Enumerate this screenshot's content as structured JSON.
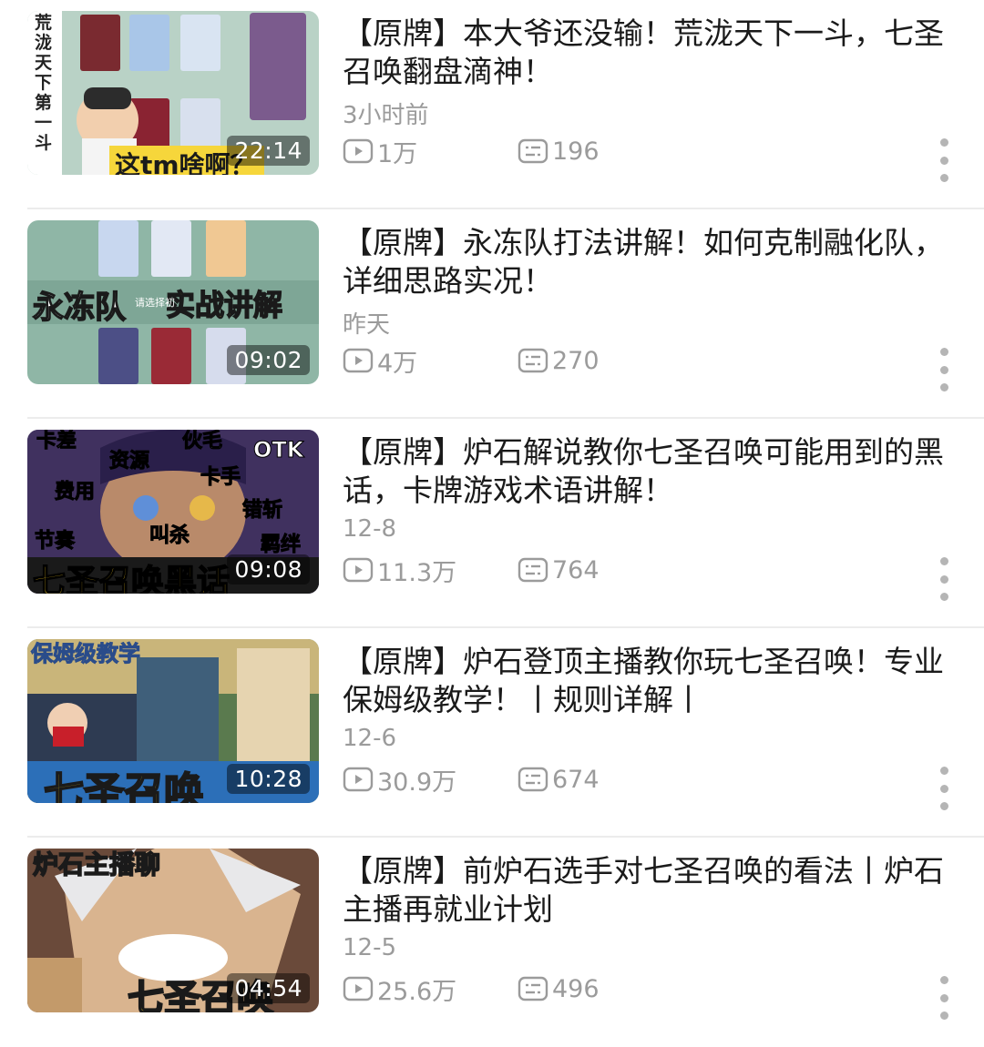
{
  "videos": [
    {
      "title": "【原牌】本大爷还没输！荒泷天下一斗，七圣召唤翻盘滴神！",
      "time": "3小时前",
      "duration": "22:14",
      "plays": "1万",
      "danmaku": "196",
      "thumb_text": [
        "荒泷天下第一斗",
        "这tm啥啊？"
      ]
    },
    {
      "title": "【原牌】永冻队打法讲解！如何克制融化队，详细思路实况！",
      "time": "昨天",
      "duration": "09:02",
      "plays": "4万",
      "danmaku": "270",
      "thumb_text": [
        "永冻队",
        "实战讲解",
        "请选择初"
      ]
    },
    {
      "title": "【原牌】炉石解说教你七圣召唤可能用到的黑话，卡牌游戏术语讲解！",
      "time": "12-8",
      "duration": "09:08",
      "plays": "11.3万",
      "danmaku": "764",
      "thumb_text": [
        "卡差",
        "资源",
        "伙毛",
        "OTK",
        "费用",
        "卡手",
        "错斩",
        "节奏",
        "叫杀",
        "羁绊",
        "七圣召唤黑话"
      ]
    },
    {
      "title": "【原牌】炉石登顶主播教你玩七圣召唤！专业保姆级教学！丨规则详解丨",
      "time": "12-6",
      "duration": "10:28",
      "plays": "30.9万",
      "danmaku": "674",
      "thumb_text": [
        "保姆级教学",
        "七圣召唤"
      ]
    },
    {
      "title": "【原牌】前炉石选手对七圣召唤的看法丨炉石主播再就业计划",
      "time": "12-5",
      "duration": "04:54",
      "plays": "25.6万",
      "danmaku": "496",
      "thumb_text": [
        "炉石主播聊",
        "七圣召唤"
      ]
    }
  ],
  "icons": {
    "plays": "play-count-icon",
    "danmaku": "danmaku-count-icon",
    "more": "more-vertical-icon"
  },
  "colors": {
    "title": "#1a1a1a",
    "secondary": "#9b9b9b",
    "divider": "#ececec"
  }
}
